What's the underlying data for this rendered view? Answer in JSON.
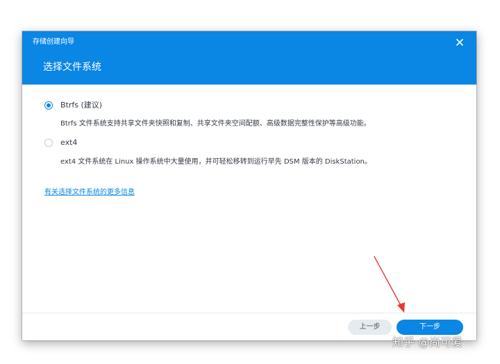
{
  "dialog": {
    "window_title": "存储创建向导",
    "step_title": "选择文件系统",
    "close_icon": "close-icon"
  },
  "options": [
    {
      "label": "Btrfs (建议)",
      "description": "Btrfs 文件系统支持共享文件夹快照和复制、共享文件夹空间配额、高级数据完整性保护等高级功能。",
      "selected": true
    },
    {
      "label": "ext4",
      "description": "ext4 文件系统在 Linux 操作系统中大量使用，并可轻松移转到运行早先 DSM 版本的 DiskStation。",
      "selected": false
    }
  ],
  "info_link": "有关选择文件系统的更多信息",
  "footer": {
    "back_label": "上一步",
    "next_label": "下一步"
  },
  "watermark": "知乎 @尚可爱",
  "colors": {
    "accent": "#0a86e5",
    "arrow": "#e53935"
  }
}
